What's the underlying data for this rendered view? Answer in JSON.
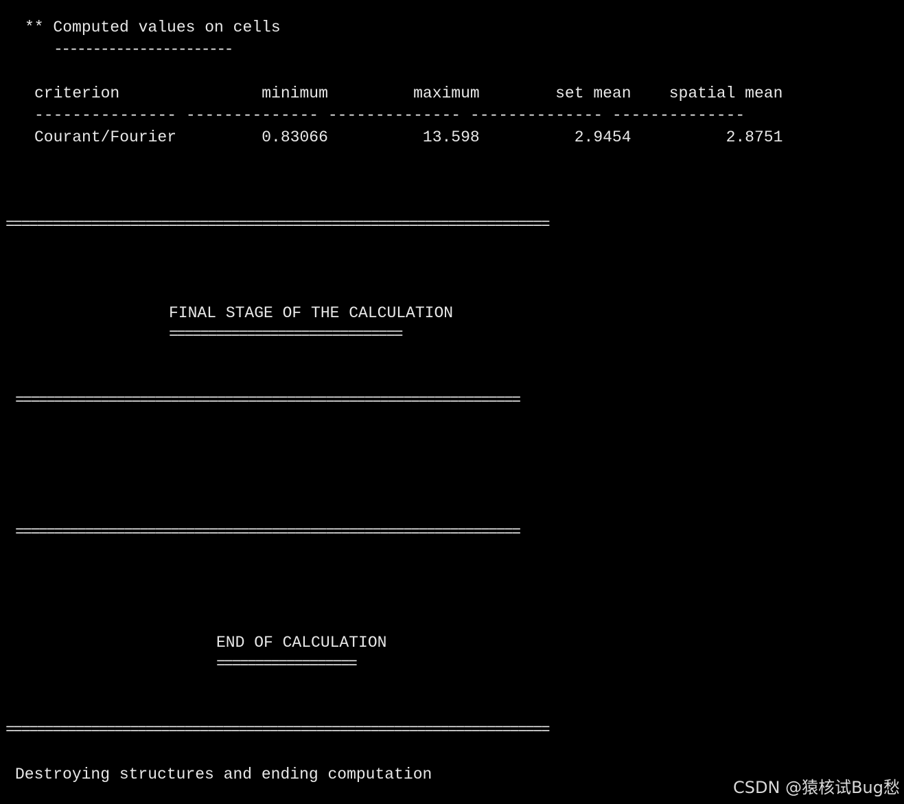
{
  "terminal": {
    "lines": {
      "heading": "** Computed values on cells",
      "heading_underline": "-----------------------",
      "table_header": "criterion               minimum         maximum        set mean    spatial mean",
      "table_divider": "--------------- -------------- -------------- -------------- --------------",
      "table_row": "Courant/Fourier         0.83066          13.598          2.9454          2.8751",
      "separator_1": "======================================================================",
      "final_stage_title": "FINAL STAGE OF THE CALCULATION",
      "final_stage_underline": "==============================",
      "separator_2": "=================================================================",
      "separator_3": "=================================================================",
      "end_title": "END OF CALCULATION",
      "end_underline": "==================",
      "separator_4": "======================================================================",
      "final_message": "Destroying structures and ending computation"
    },
    "table": {
      "columns": [
        "criterion",
        "minimum",
        "maximum",
        "set mean",
        "spatial mean"
      ],
      "rows": [
        [
          "Courant/Fourier",
          "0.83066",
          "13.598",
          "2.9454",
          "2.8751"
        ]
      ]
    }
  },
  "watermark": {
    "text": "CSDN @猿核试Bug愁"
  },
  "colors": {
    "background": "#000000",
    "text": "#e8e8e8"
  }
}
